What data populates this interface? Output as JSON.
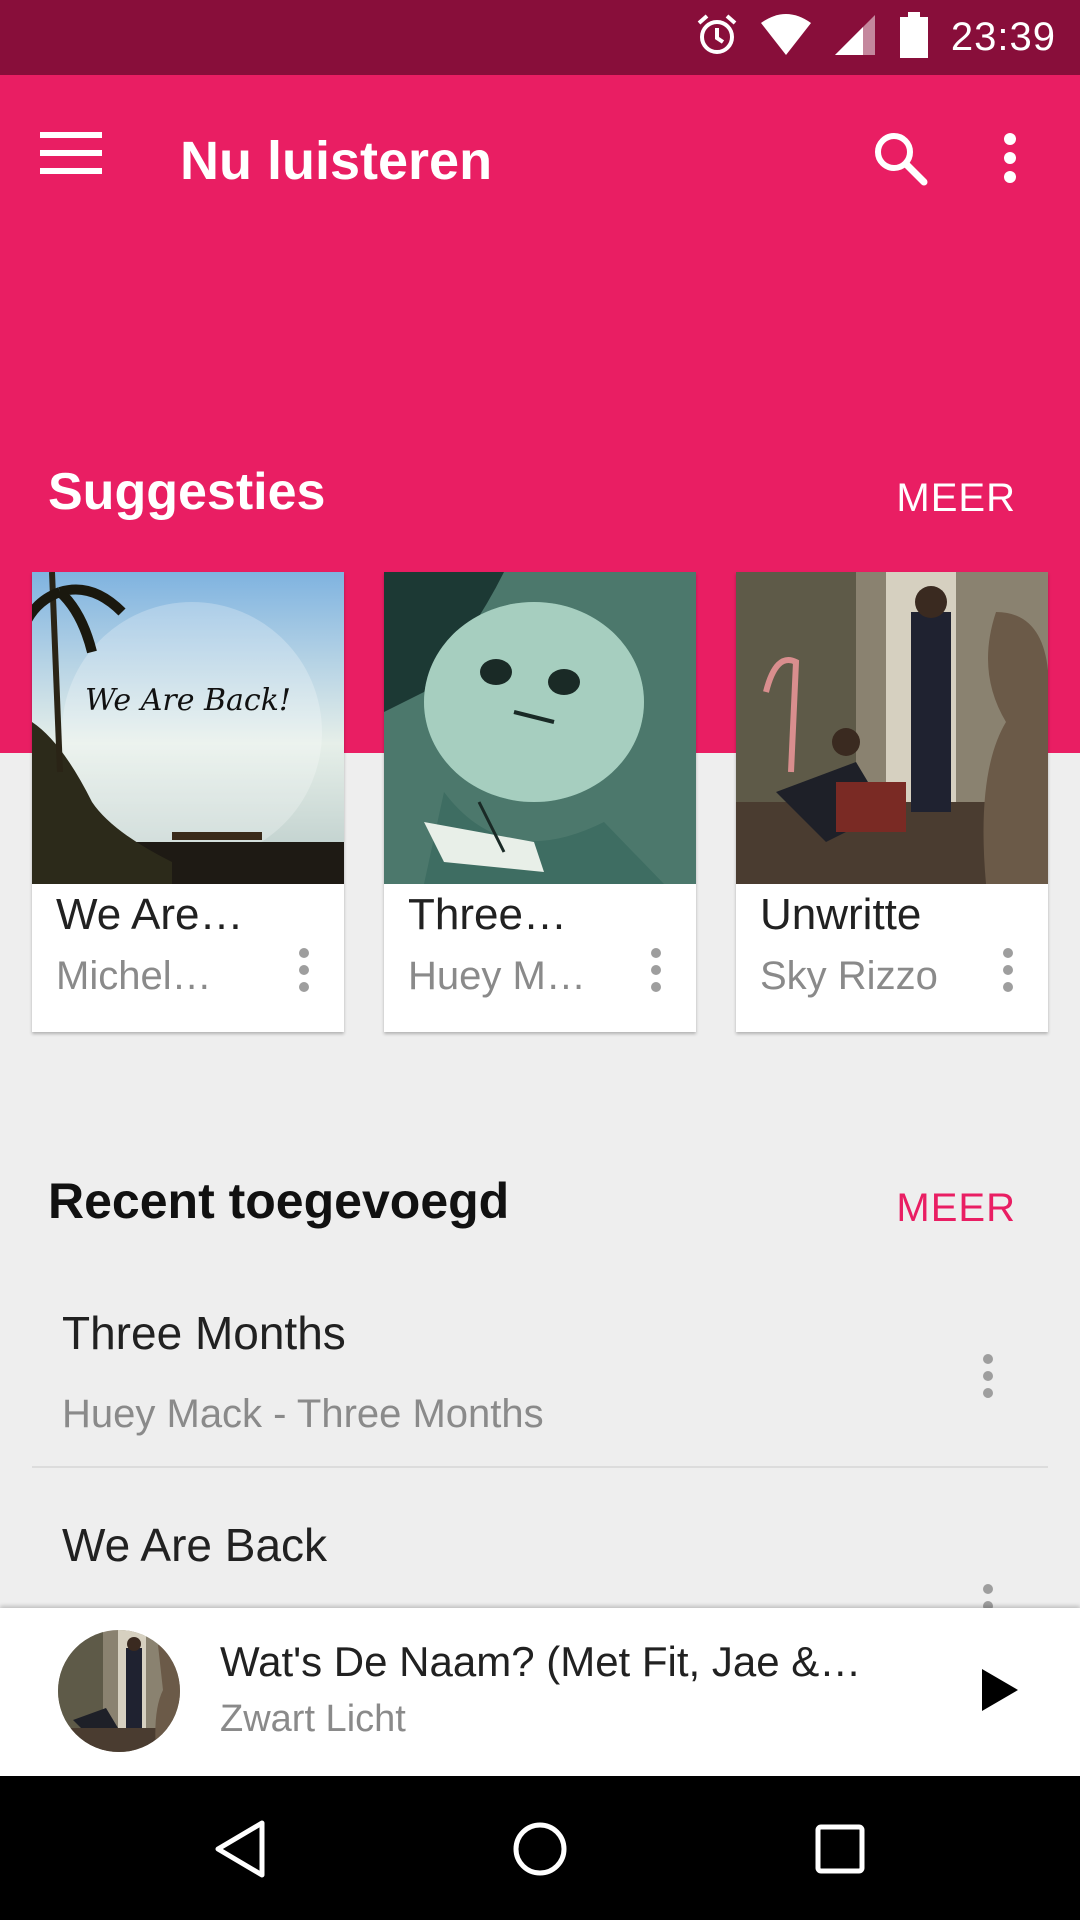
{
  "status_bar": {
    "time": "23:39",
    "icons": [
      "alarm-icon",
      "wifi-icon",
      "cell-signal-icon",
      "battery-icon"
    ]
  },
  "toolbar": {
    "title": "Nu luisteren",
    "menu_icon": "hamburger-menu-icon",
    "search_icon": "search-icon",
    "overflow_icon": "more-vert-icon"
  },
  "colors": {
    "primary": "#e91e63",
    "primary_dark": "#880e3a",
    "accent": "#e91e63",
    "background": "#eeeeee"
  },
  "suggestions": {
    "title": "Suggesties",
    "more_label": "MEER",
    "cards": [
      {
        "title": "We Are…",
        "subtitle": "Michel…",
        "art_text": "We Are Back!"
      },
      {
        "title": "Three…",
        "subtitle": "Huey M…"
      },
      {
        "title": "Unwritte",
        "subtitle": "Sky Rizzo"
      }
    ]
  },
  "recent": {
    "title": "Recent toegevoegd",
    "more_label": "MEER",
    "items": [
      {
        "title": "Three Months",
        "subtitle": "Huey Mack - Three Months"
      },
      {
        "title": "We Are Back",
        "subtitle": ""
      }
    ]
  },
  "now_playing": {
    "title": "Wat's De Naam? (Met Fit, Jae &…",
    "artist": "Zwart Licht",
    "play_icon": "play-icon"
  },
  "nav_bar": {
    "icons": [
      "back-icon",
      "home-icon",
      "recents-icon"
    ]
  }
}
